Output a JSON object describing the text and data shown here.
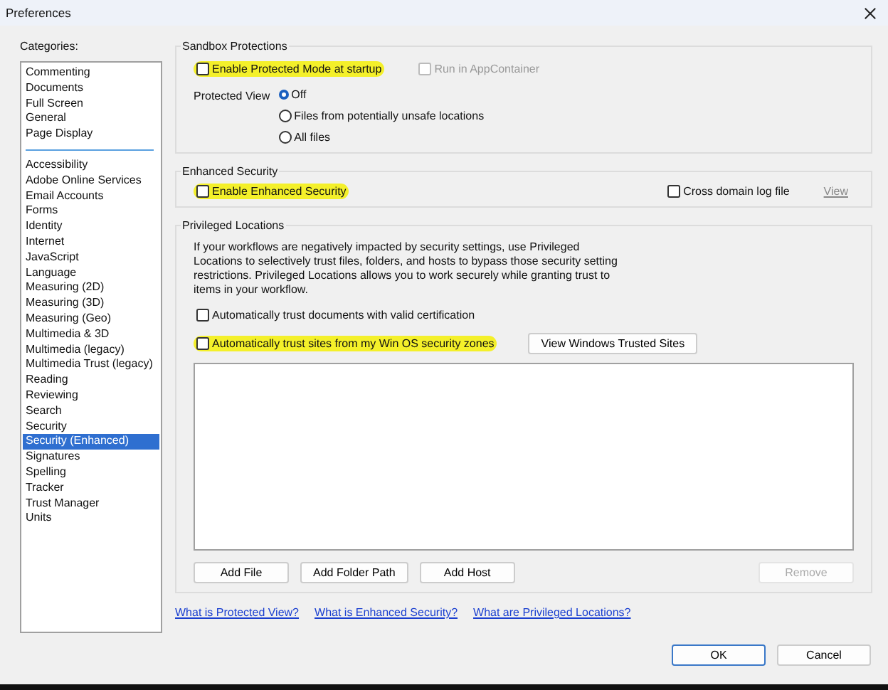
{
  "window": {
    "title": "Preferences"
  },
  "categories": {
    "label": "Categories:",
    "sections": [
      [
        {
          "label": "Commenting",
          "selected": false
        },
        {
          "label": "Documents",
          "selected": false
        },
        {
          "label": "Full Screen",
          "selected": false
        },
        {
          "label": "General",
          "selected": false
        },
        {
          "label": "Page Display",
          "selected": false
        }
      ],
      [
        {
          "label": "Accessibility",
          "selected": false
        },
        {
          "label": "Adobe Online Services",
          "selected": false
        },
        {
          "label": "Email Accounts",
          "selected": false
        },
        {
          "label": "Forms",
          "selected": false
        },
        {
          "label": "Identity",
          "selected": false
        },
        {
          "label": "Internet",
          "selected": false
        },
        {
          "label": "JavaScript",
          "selected": false
        },
        {
          "label": "Language",
          "selected": false
        },
        {
          "label": "Measuring (2D)",
          "selected": false
        },
        {
          "label": "Measuring (3D)",
          "selected": false
        },
        {
          "label": "Measuring (Geo)",
          "selected": false
        },
        {
          "label": "Multimedia & 3D",
          "selected": false
        },
        {
          "label": "Multimedia (legacy)",
          "selected": false
        },
        {
          "label": "Multimedia Trust (legacy)",
          "selected": false
        },
        {
          "label": "Reading",
          "selected": false
        },
        {
          "label": "Reviewing",
          "selected": false
        },
        {
          "label": "Search",
          "selected": false
        },
        {
          "label": "Security",
          "selected": false
        },
        {
          "label": "Security (Enhanced)",
          "selected": true
        },
        {
          "label": "Signatures",
          "selected": false
        },
        {
          "label": "Spelling",
          "selected": false
        },
        {
          "label": "Tracker",
          "selected": false
        },
        {
          "label": "Trust Manager",
          "selected": false
        },
        {
          "label": "Units",
          "selected": false
        }
      ]
    ]
  },
  "sandbox": {
    "title": "Sandbox Protections",
    "checkboxes": [
      {
        "label": "Enable Protected Mode at startup",
        "checked": false,
        "disabled": false,
        "highlighted": true
      },
      {
        "label": "Run in AppContainer",
        "checked": false,
        "disabled": true,
        "highlighted": false
      }
    ],
    "protected_view": {
      "label": "Protected View",
      "options": [
        {
          "label": "Off",
          "selected": true
        },
        {
          "label": "Files from potentially unsafe locations",
          "selected": false
        },
        {
          "label": "All files",
          "selected": false
        }
      ]
    }
  },
  "enhanced": {
    "title": "Enhanced Security",
    "checkboxes": [
      {
        "label": "Enable Enhanced Security",
        "checked": false,
        "disabled": false,
        "highlighted": true
      },
      {
        "label": "Cross domain log file",
        "checked": false,
        "disabled": false,
        "highlighted": false
      }
    ],
    "view_link": {
      "label": "View",
      "disabled": true
    }
  },
  "privileged": {
    "title": "Privileged Locations",
    "description": "If your workflows are negatively impacted by security settings, use Privileged Locations to selectively trust files, folders, and hosts to bypass those security setting restrictions. Privileged Locations allows you to work securely while granting trust to items in your workflow.",
    "checkboxes": [
      {
        "label": "Automatically trust documents with valid certification",
        "checked": false,
        "disabled": false,
        "highlighted": false
      },
      {
        "label": "Automatically trust sites from my Win OS security zones",
        "checked": false,
        "disabled": false,
        "highlighted": true
      }
    ],
    "trusted_sites_button": "View Windows Trusted Sites",
    "buttons": [
      {
        "label": "Add File",
        "disabled": false
      },
      {
        "label": "Add Folder Path",
        "disabled": false
      },
      {
        "label": "Add Host",
        "disabled": false
      },
      {
        "label": "Remove",
        "disabled": true
      }
    ]
  },
  "links": [
    "What is Protected View?",
    "What is Enhanced Security?",
    "What are Privileged Locations?"
  ],
  "footer_buttons": [
    {
      "label": "OK",
      "default": true
    },
    {
      "label": "Cancel",
      "default": false
    }
  ]
}
